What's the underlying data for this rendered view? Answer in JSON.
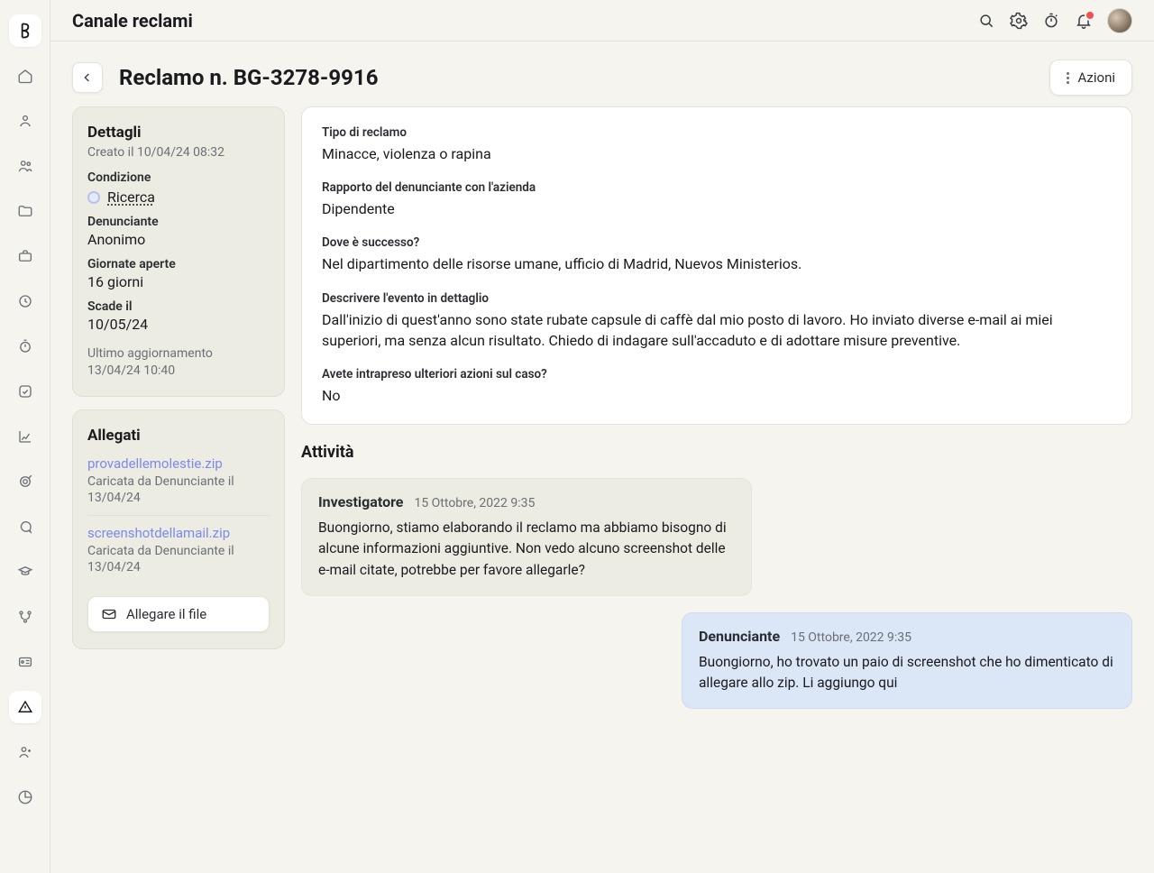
{
  "header": {
    "title": "Canale reclami"
  },
  "subheader": {
    "title": "Reclamo n. BG-3278-9916",
    "actions_label": "Azioni"
  },
  "details": {
    "title": "Dettagli",
    "created": "Creato il 10/04/24 08:32",
    "status_label": "Condizione",
    "status_value": "Ricerca",
    "reporter_label": "Denunciante",
    "reporter_value": "Anonimo",
    "open_days_label": "Giornate aperte",
    "open_days_value": "16 giorni",
    "expires_label": "Scade il",
    "expires_value": "10/05/24",
    "last_update_label": "Ultimo aggiornamento",
    "last_update_value": "13/04/24 10:40"
  },
  "attachments": {
    "title": "Allegati",
    "attach_button": "Allegare il file",
    "items": [
      {
        "name": "provadellemolestie.zip",
        "meta": "Caricata da Denunciante il 13/04/24"
      },
      {
        "name": "screenshotdellamail.zip",
        "meta": "Caricata da Denunciante il 13/04/24"
      }
    ]
  },
  "report": {
    "type_label": "Tipo di reclamo",
    "type_value": "Minacce, violenza o rapina",
    "relation_label": "Rapporto del denunciante con l'azienda",
    "relation_value": "Dipendente",
    "where_label": "Dove è successo?",
    "where_value": "Nel dipartimento delle risorse umane, ufficio di Madrid, Nuevos Ministerios.",
    "detail_label": "Descrivere l'evento in dettaglio",
    "detail_value": "Dall'inizio di quest'anno sono state rubate capsule di caffè dal mio posto di lavoro. Ho inviato diverse e-mail ai miei superiori, ma senza alcun risultato. Chiedo di indagare sull'accaduto e di adottare misure preventive.",
    "further_label": "Avete intrapreso ulteriori azioni sul caso?",
    "further_value": "No"
  },
  "activity": {
    "title": "Attività",
    "messages": [
      {
        "role": "Investigatore",
        "time": "15 Ottobre, 2022 9:35",
        "body": "Buongiorno, stiamo elaborando il reclamo ma abbiamo bisogno di alcune informazioni aggiuntive. Non vedo alcuno screenshot delle e-mail citate, potrebbe per favore allegarle?"
      },
      {
        "role": "Denunciante",
        "time": "15 Ottobre, 2022 9:35",
        "body": "Buongiorno, ho trovato un paio di screenshot che ho dimenticato di allegare allo zip. Li aggiungo qui"
      }
    ]
  }
}
